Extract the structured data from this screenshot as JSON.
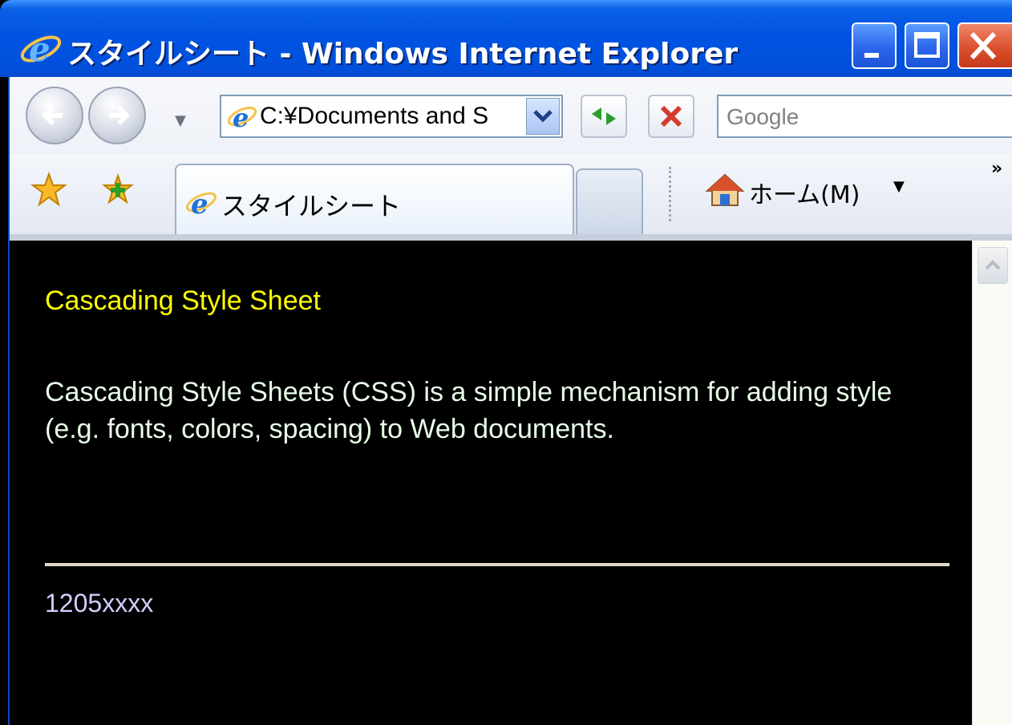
{
  "window": {
    "title": "スタイルシート - Windows Internet Explorer",
    "buttons": {
      "minimize": "minimize",
      "maximize": "maximize",
      "close": "close"
    }
  },
  "address_bar": {
    "url": "C:¥Documents and S"
  },
  "search": {
    "placeholder": "Google"
  },
  "tabs": [
    {
      "label": "スタイルシート"
    }
  ],
  "command_bar": {
    "home_label": "ホーム(M)",
    "more": "»"
  },
  "page": {
    "heading": "Cascading Style Sheet",
    "paragraph": "Cascading Style Sheets (CSS) is a simple mechanism for adding style (e.g. fonts, colors, spacing) to Web documents.",
    "footer": "1205xxxx"
  },
  "colors": {
    "titlebar": "#0053e1",
    "page_background": "#000000",
    "heading": "#ffff00",
    "paragraph": "#e8ffe8",
    "footer": "#d0d0ff"
  }
}
